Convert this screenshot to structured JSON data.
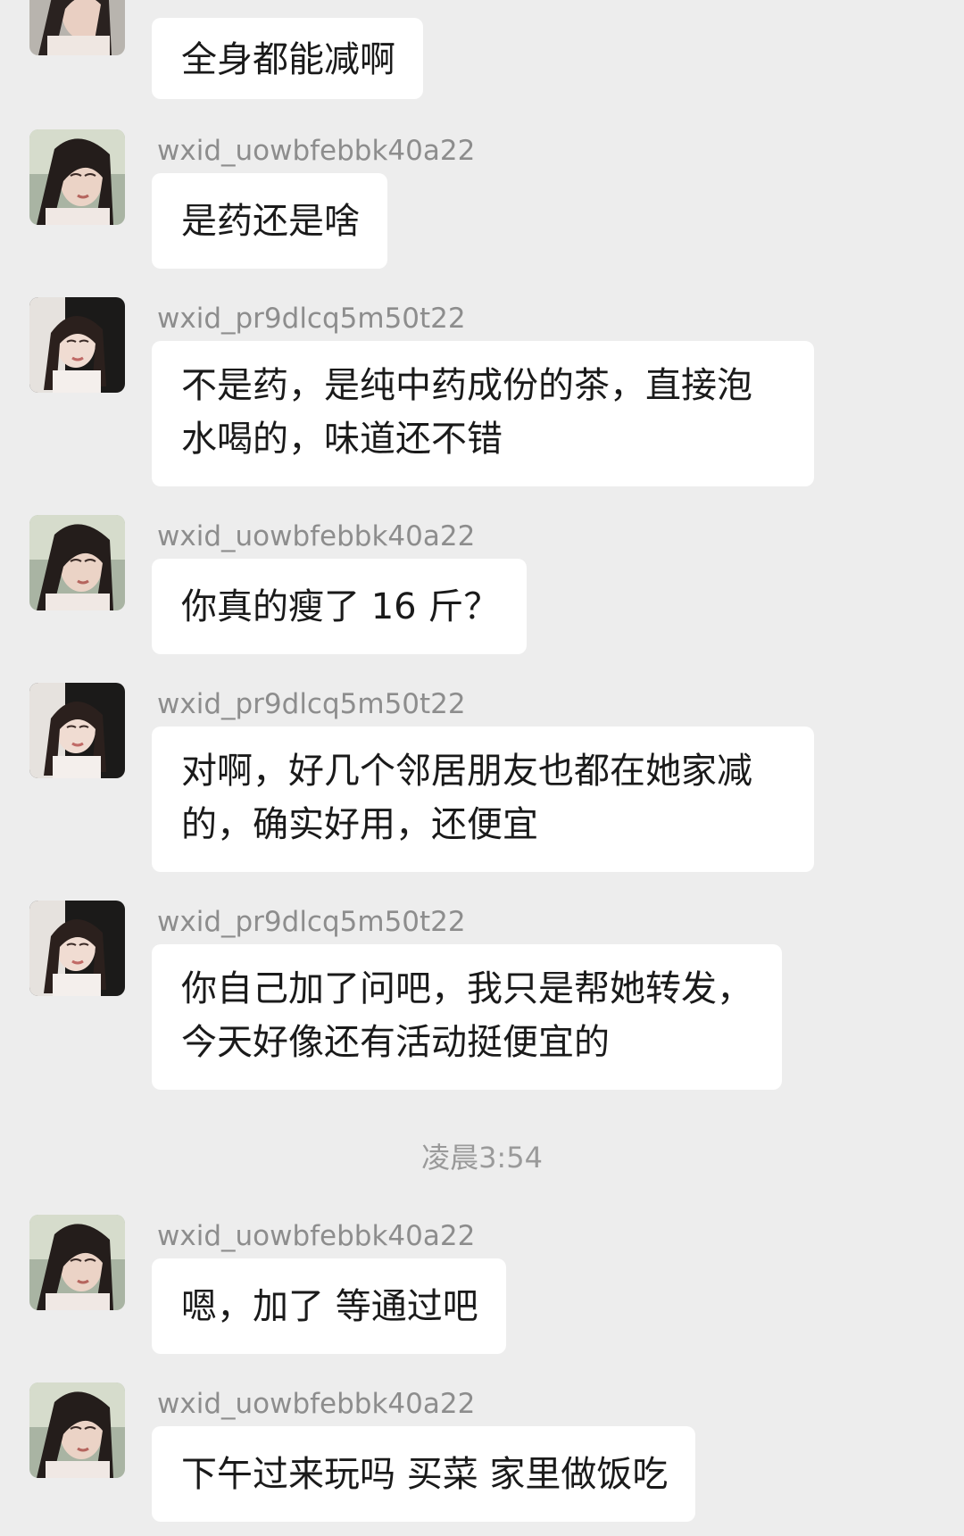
{
  "messages": [
    {
      "sender": "",
      "avatar": "avatar-b",
      "text": "全身都能减啊"
    },
    {
      "sender": "wxid_uowbfebbk40a22",
      "avatar": "avatar-b",
      "text": "是药还是啥"
    },
    {
      "sender": "wxid_pr9dlcq5m50t22",
      "avatar": "avatar-a",
      "text": "不是药，是纯中药成份的茶，直接泡水喝的，味道还不错"
    },
    {
      "sender": "wxid_uowbfebbk40a22",
      "avatar": "avatar-b",
      "text": "你真的瘦了 16 斤？"
    },
    {
      "sender": "wxid_pr9dlcq5m50t22",
      "avatar": "avatar-a",
      "text": "对啊，好几个邻居朋友也都在她家减的，确实好用，还便宜"
    },
    {
      "sender": "wxid_pr9dlcq5m50t22",
      "avatar": "avatar-a",
      "text": "你自己加了问吧，我只是帮她转发，今天好像还有活动挺便宜的"
    },
    {
      "sender": "wxid_uowbfebbk40a22",
      "avatar": "avatar-b",
      "text": "嗯，加了 等通过吧"
    },
    {
      "sender": "wxid_uowbfebbk40a22",
      "avatar": "avatar-b",
      "text": "下午过来玩吗 买菜 家里做饭吃"
    }
  ],
  "timestamp": "凌晨3:54",
  "colors": {
    "background": "#ededed",
    "bubble": "#ffffff",
    "sender_text": "#8d8d8d",
    "message_text": "#1a1a1a",
    "timestamp_text": "#9a9a9a"
  }
}
